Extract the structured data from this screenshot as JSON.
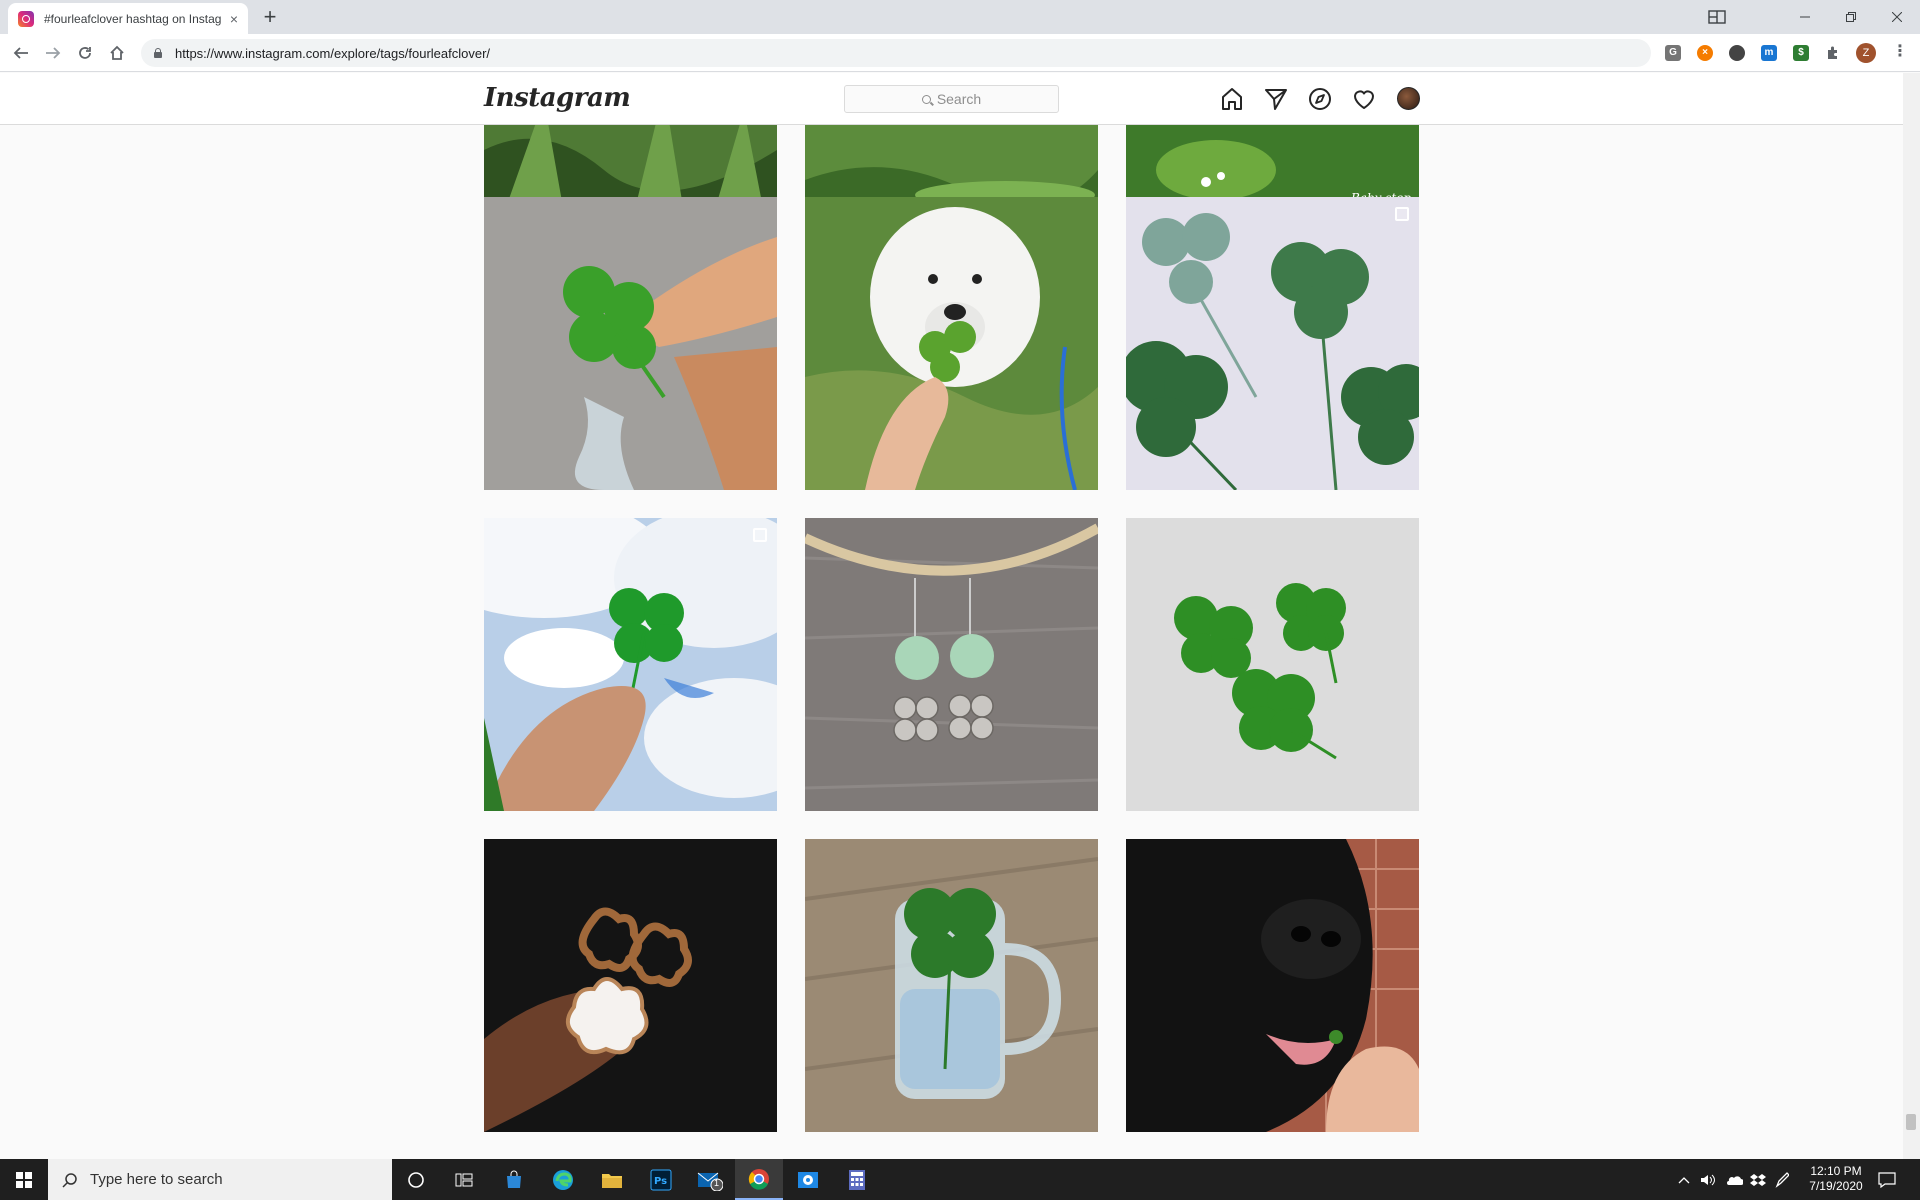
{
  "browser": {
    "tab_title": "#fourleafclover hashtag on Instagram",
    "tab_close": "×",
    "new_tab": "+",
    "url": "https://www.instagram.com/explore/tags/fourleafclover/",
    "profile_initial": "Z"
  },
  "instagram": {
    "logo": "Instagram",
    "search_placeholder": "Search",
    "nav_icons": [
      "home-icon",
      "direct-icon",
      "explore-icon",
      "activity-icon"
    ],
    "posts": [
      {
        "overlay": "",
        "multi": false
      },
      {
        "overlay": "",
        "multi": false
      },
      {
        "overlay": "Baby step",
        "multi": false
      },
      {
        "overlay": "",
        "multi": false
      },
      {
        "overlay": "",
        "multi": false
      },
      {
        "overlay": "",
        "multi": true
      },
      {
        "overlay": "",
        "multi": true
      },
      {
        "overlay": "",
        "multi": false
      },
      {
        "overlay": "",
        "multi": false
      },
      {
        "overlay": "",
        "multi": false
      },
      {
        "overlay": "",
        "multi": false
      },
      {
        "overlay": "",
        "multi": false
      }
    ]
  },
  "taskbar": {
    "search_placeholder": "Type here to search",
    "mail_badge": "1",
    "time": "12:10 PM",
    "date": "7/19/2020"
  },
  "colors": {
    "ig_text": "#262626",
    "ig_border": "#dbdbdb",
    "chrome_tabbar": "#dee1e6"
  }
}
